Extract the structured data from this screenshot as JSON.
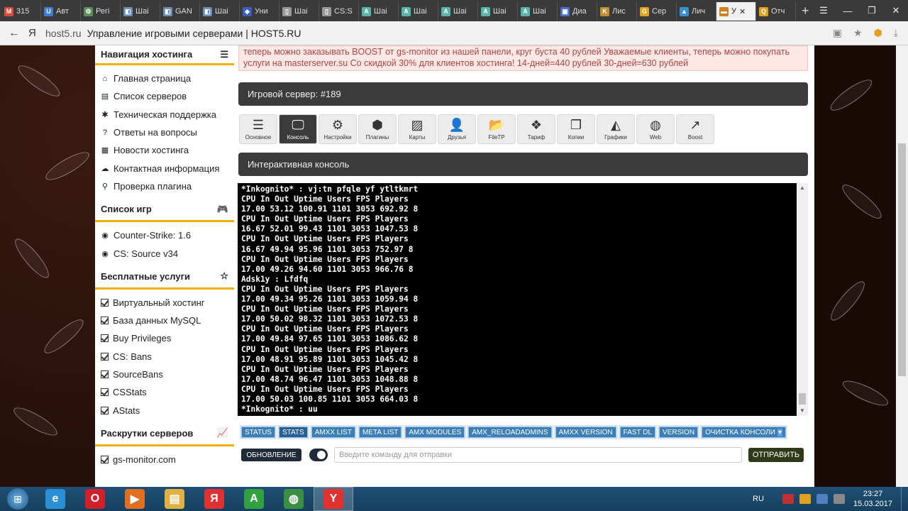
{
  "browser": {
    "tabs": [
      {
        "label": "315",
        "color": "#d94a38",
        "glyph": "M"
      },
      {
        "label": "Авт",
        "color": "#3b7dd8",
        "glyph": "U"
      },
      {
        "label": "Регі",
        "color": "#5a8f5a",
        "glyph": "⚙"
      },
      {
        "label": "Шаі",
        "color": "#6c8fb5",
        "glyph": "◧"
      },
      {
        "label": "GAN",
        "color": "#6c8fb5",
        "glyph": "◧"
      },
      {
        "label": "Шаі",
        "color": "#6c8fb5",
        "glyph": "◧"
      },
      {
        "label": "Уни",
        "color": "#3a5fc0",
        "glyph": "◈"
      },
      {
        "label": "Шаі",
        "color": "#999999",
        "glyph": "▯"
      },
      {
        "label": "CS:S",
        "color": "#999999",
        "glyph": "▯"
      },
      {
        "label": "Шаі",
        "color": "#58b4a8",
        "glyph": "A"
      },
      {
        "label": "Шаі",
        "color": "#58b4a8",
        "glyph": "A"
      },
      {
        "label": "Шаі",
        "color": "#58b4a8",
        "glyph": "A"
      },
      {
        "label": "Шаі",
        "color": "#58b4a8",
        "glyph": "A"
      },
      {
        "label": "Шаі",
        "color": "#58b4a8",
        "glyph": "A"
      },
      {
        "label": "Диа",
        "color": "#4a6fcf",
        "glyph": "▣"
      },
      {
        "label": "Лис",
        "color": "#c09030",
        "glyph": "K"
      },
      {
        "label": "Сер",
        "color": "#e0a020",
        "glyph": "G"
      },
      {
        "label": "Лич",
        "color": "#3a8fd0",
        "glyph": "▲"
      },
      {
        "label": "У",
        "color": "#d08020",
        "glyph": "▬",
        "active": true
      },
      {
        "label": "Отч",
        "color": "#e0a020",
        "glyph": "Q"
      }
    ],
    "new_tab": "+",
    "address": {
      "back": "←",
      "ya": "Я",
      "domain": "host5.ru",
      "title": "Управление игровыми серверами | HOST5.RU"
    }
  },
  "sidebar": {
    "sections": [
      {
        "title": "Навигация хостинга",
        "icon": "menu-icon",
        "items": [
          {
            "label": "Главная страница",
            "icon": "home-icon",
            "glyph": "⌂"
          },
          {
            "label": "Список серверов",
            "icon": "list-icon",
            "glyph": "▤"
          },
          {
            "label": "Техническая поддержка",
            "icon": "support-icon",
            "glyph": "✱"
          },
          {
            "label": "Ответы на вопросы",
            "icon": "question-icon",
            "glyph": "?"
          },
          {
            "label": "Новости хостинга",
            "icon": "news-icon",
            "glyph": "▦"
          },
          {
            "label": "Контактная информация",
            "icon": "contacts-icon",
            "glyph": "☁"
          },
          {
            "label": "Проверка плагина",
            "icon": "search-icon",
            "glyph": "⚲"
          }
        ]
      },
      {
        "title": "Список игр",
        "icon": "gamepad-icon",
        "items": [
          {
            "label": "Counter-Strike: 1.6",
            "icon": "steam-icon",
            "glyph": "◉"
          },
          {
            "label": "CS: Source v34",
            "icon": "steam-icon",
            "glyph": "◉"
          }
        ]
      },
      {
        "title": "Бесплатные услуги",
        "icon": "star-icon",
        "items": [
          {
            "label": "Виртуальный хостинг",
            "icon": "check-icon"
          },
          {
            "label": "База данных MySQL",
            "icon": "check-icon"
          },
          {
            "label": "Buy Privileges",
            "icon": "check-icon"
          },
          {
            "label": "CS: Bans",
            "icon": "check-icon"
          },
          {
            "label": "SourceBans",
            "icon": "check-icon"
          },
          {
            "label": "CSStats",
            "icon": "check-icon"
          },
          {
            "label": "AStats",
            "icon": "check-icon"
          }
        ]
      },
      {
        "title": "Раскрутки серверов",
        "icon": "chart-icon",
        "items": [
          {
            "label": "gs-monitor.com",
            "icon": "check-icon"
          }
        ]
      }
    ]
  },
  "main": {
    "notice": "теперь можно заказывать BOOST от gs-monitor из нашей панели, круг буста 40 рублей Уважаемые клиенты, теперь можно покупать услуги на masterserver.su Со скидкой 30% для клиентов хостинга! 14-дней=440 рублей 30-дней=630 рублей",
    "server_title": "Игровой сервер: #189",
    "tools": [
      {
        "label": "Основное",
        "icon": "bars-icon",
        "glyph": "☰"
      },
      {
        "label": "Консоль",
        "icon": "monitor-icon",
        "glyph": "🖵",
        "active": true
      },
      {
        "label": "Настройки",
        "icon": "gear-icon",
        "glyph": "⚙"
      },
      {
        "label": "Плагины",
        "icon": "cubes-icon",
        "glyph": "⬢"
      },
      {
        "label": "Карты",
        "icon": "image-icon",
        "glyph": "▨"
      },
      {
        "label": "Друзья",
        "icon": "add-user-icon",
        "glyph": "👤"
      },
      {
        "label": "FileTP",
        "icon": "folder-icon",
        "glyph": "📂"
      },
      {
        "label": "Тариф",
        "icon": "dropbox-icon",
        "glyph": "❖"
      },
      {
        "label": "Копии",
        "icon": "copy-icon",
        "glyph": "❐"
      },
      {
        "label": "Графики",
        "icon": "area-chart-icon",
        "glyph": "◭"
      },
      {
        "label": "Web",
        "icon": "globe-icon",
        "glyph": "◍"
      },
      {
        "label": "Boost",
        "icon": "line-chart-icon",
        "glyph": "↗"
      }
    ],
    "console_title": "Интерактивная консоль",
    "console_lines": [
      "*Inkognito* : vj:tn pfqle yf ytltkmrt",
      "CPU In Out Uptime Users FPS Players",
      "17.00 53.12 100.91 1101 3053 692.92 8",
      "CPU In Out Uptime Users FPS Players",
      "16.67 52.01 99.43 1101 3053 1047.53 8",
      "CPU In Out Uptime Users FPS Players",
      "16.67 49.94 95.96 1101 3053 752.97 8",
      "CPU In Out Uptime Users FPS Players",
      "17.00 49.26 94.60 1101 3053 966.76 8",
      "Adsk1y : Lfdfq",
      "CPU In Out Uptime Users FPS Players",
      "17.00 49.34 95.26 1101 3053 1059.94 8",
      "CPU In Out Uptime Users FPS Players",
      "17.00 50.02 98.32 1101 3053 1072.53 8",
      "CPU In Out Uptime Users FPS Players",
      "17.00 49.84 97.65 1101 3053 1086.62 8",
      "CPU In Out Uptime Users FPS Players",
      "17.00 48.91 95.89 1101 3053 1045.42 8",
      "CPU In Out Uptime Users FPS Players",
      "17.00 48.74 96.47 1101 3053 1048.88 8",
      "CPU In Out Uptime Users FPS Players",
      "17.00 50.03 100.85 1101 3053 664.03 8",
      "*Inkognito* : uu"
    ],
    "commands": [
      "STATUS",
      "STATS",
      "AMXX LIST",
      "META LIST",
      "AMX MODULES",
      "AMX_RELOADADMINS",
      "AMXX VERSION",
      "FAST DL",
      "VERSION",
      "ОЧИСТКА КОНСОЛИ"
    ],
    "refresh_label": "ОБНОВЛЕНИЕ",
    "input_placeholder": "Введите команду для отправки",
    "send_label": "ОТПРАВИТЬ"
  },
  "taskbar": {
    "apps": [
      {
        "name": "ie",
        "color": "#2b8fd6",
        "glyph": "e"
      },
      {
        "name": "opera",
        "color": "#d0202a",
        "glyph": "O"
      },
      {
        "name": "media-player",
        "color": "#e07020",
        "glyph": "▶"
      },
      {
        "name": "explorer",
        "color": "#e0b040",
        "glyph": "▤"
      },
      {
        "name": "yandex-browser",
        "color": "#e03030",
        "glyph": "Я"
      },
      {
        "name": "app-a",
        "color": "#30a040",
        "glyph": "A"
      },
      {
        "name": "chrome",
        "color": "#3a9040",
        "glyph": "◍"
      },
      {
        "name": "yandex",
        "color": "#e03030",
        "glyph": "Y",
        "active": true
      }
    ],
    "lang": "RU",
    "time": "23:27",
    "date": "15.03.2017"
  },
  "colors": {
    "accent": "#f0b000",
    "dark": "#3b3b3b",
    "command_blue": "#3c7eb7",
    "send_green": "#2f3b16"
  }
}
